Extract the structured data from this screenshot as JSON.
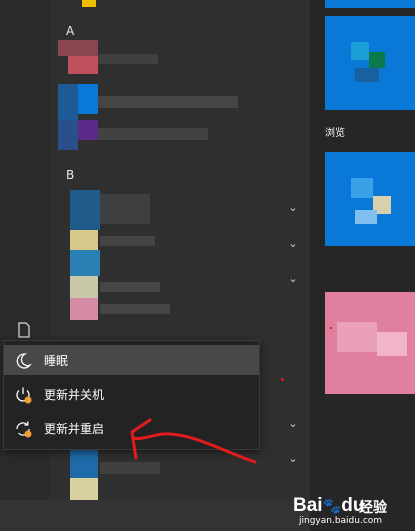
{
  "start_menu": {
    "section_letters": [
      "A",
      "B"
    ],
    "tile_label": "浏览"
  },
  "power_menu": {
    "items": [
      {
        "label": "睡眠",
        "icon": "moon-icon"
      },
      {
        "label": "更新并关机",
        "icon": "power-update-icon"
      },
      {
        "label": "更新并重启",
        "icon": "restart-update-icon"
      }
    ]
  },
  "watermark": {
    "logo": "Bai",
    "logo_suffix": "du",
    "jingyan": "经验",
    "url": "jingyan.baidu.com"
  },
  "colors": {
    "annotation_arrow": "#e21c1c",
    "update_badge": "#f0a030",
    "tile_blue": "#0a78d7",
    "tile_pink": "#e07f9e"
  }
}
